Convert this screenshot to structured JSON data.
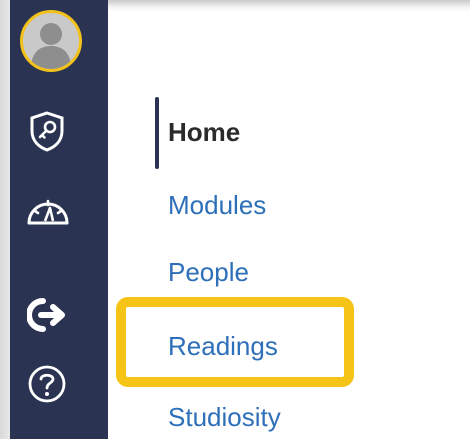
{
  "nav": {
    "items": [
      {
        "label": "Home"
      },
      {
        "label": "Modules"
      },
      {
        "label": "People"
      },
      {
        "label": "Readings"
      },
      {
        "label": "Studiosity"
      }
    ]
  },
  "rail": {
    "icons": [
      "account-avatar-icon",
      "admin-shield-icon",
      "dashboard-gauge-icon",
      "logout-arrow-icon",
      "help-icon"
    ]
  },
  "colors": {
    "rail": "#2a3452",
    "link": "#2d6fb8",
    "highlight": "#f6c416",
    "avatar_ring": "#f2c21b"
  }
}
